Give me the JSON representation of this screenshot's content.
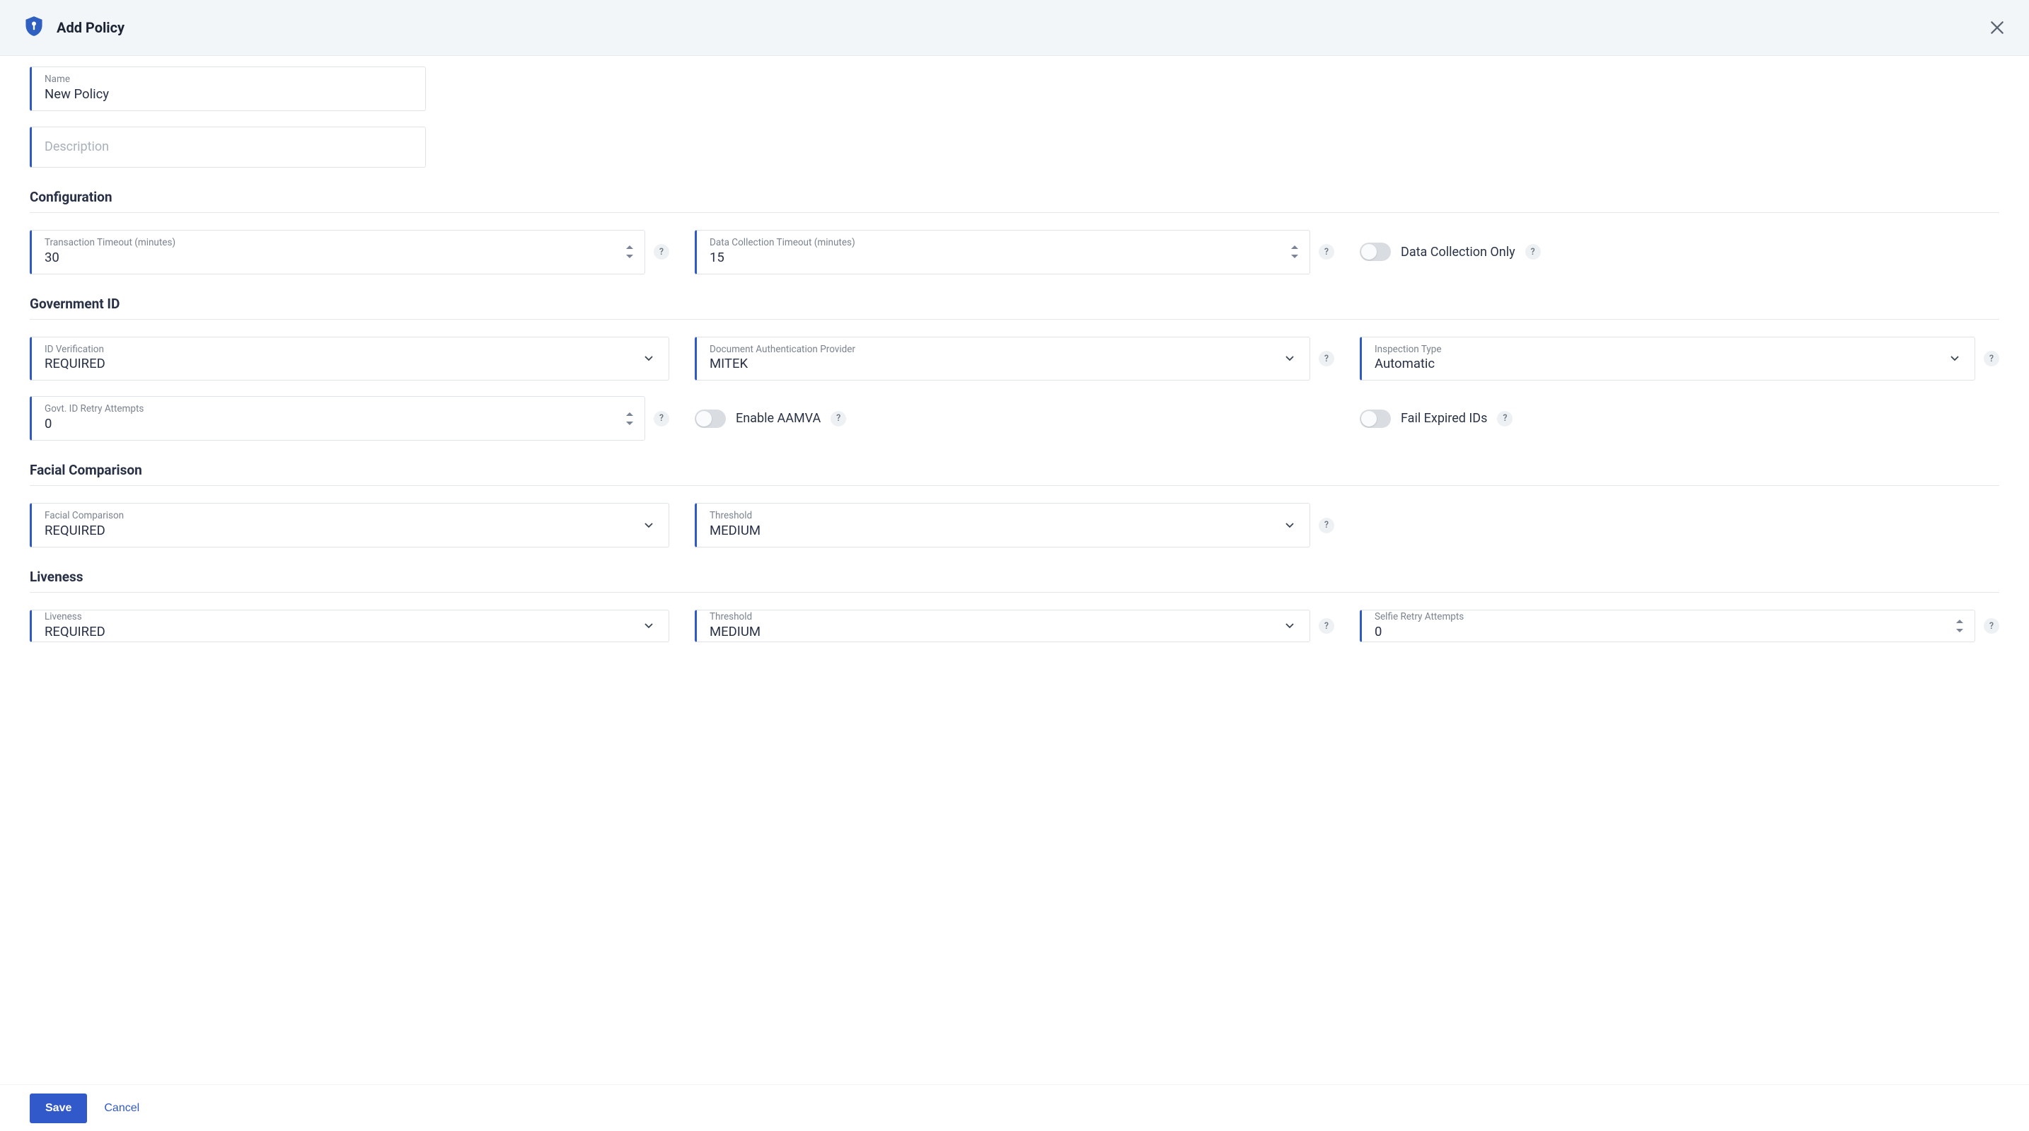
{
  "header": {
    "title": "Add Policy"
  },
  "top": {
    "name_label": "Name",
    "name_value": "New Policy",
    "description_placeholder": "Description"
  },
  "sections": {
    "configuration": {
      "title": "Configuration",
      "transaction_timeout_label": "Transaction Timeout (minutes)",
      "transaction_timeout_value": "30",
      "data_collection_timeout_label": "Data Collection Timeout (minutes)",
      "data_collection_timeout_value": "15",
      "data_collection_only_label": "Data Collection Only"
    },
    "government_id": {
      "title": "Government ID",
      "id_verification_label": "ID Verification",
      "id_verification_value": "REQUIRED",
      "doc_auth_provider_label": "Document Authentication Provider",
      "doc_auth_provider_value": "MITEK",
      "inspection_type_label": "Inspection Type",
      "inspection_type_value": "Automatic",
      "retry_label": "Govt. ID Retry Attempts",
      "retry_value": "0",
      "enable_aamva_label": "Enable AAMVA",
      "fail_expired_label": "Fail Expired IDs"
    },
    "facial": {
      "title": "Facial Comparison",
      "facial_label": "Facial Comparison",
      "facial_value": "REQUIRED",
      "threshold_label": "Threshold",
      "threshold_value": "MEDIUM"
    },
    "liveness": {
      "title": "Liveness",
      "liveness_label": "Liveness",
      "liveness_value": "REQUIRED",
      "threshold_label": "Threshold",
      "threshold_value": "MEDIUM",
      "selfie_retry_label": "Selfie Retry Attempts",
      "selfie_retry_value": "0"
    }
  },
  "footer": {
    "save": "Save",
    "cancel": "Cancel"
  }
}
